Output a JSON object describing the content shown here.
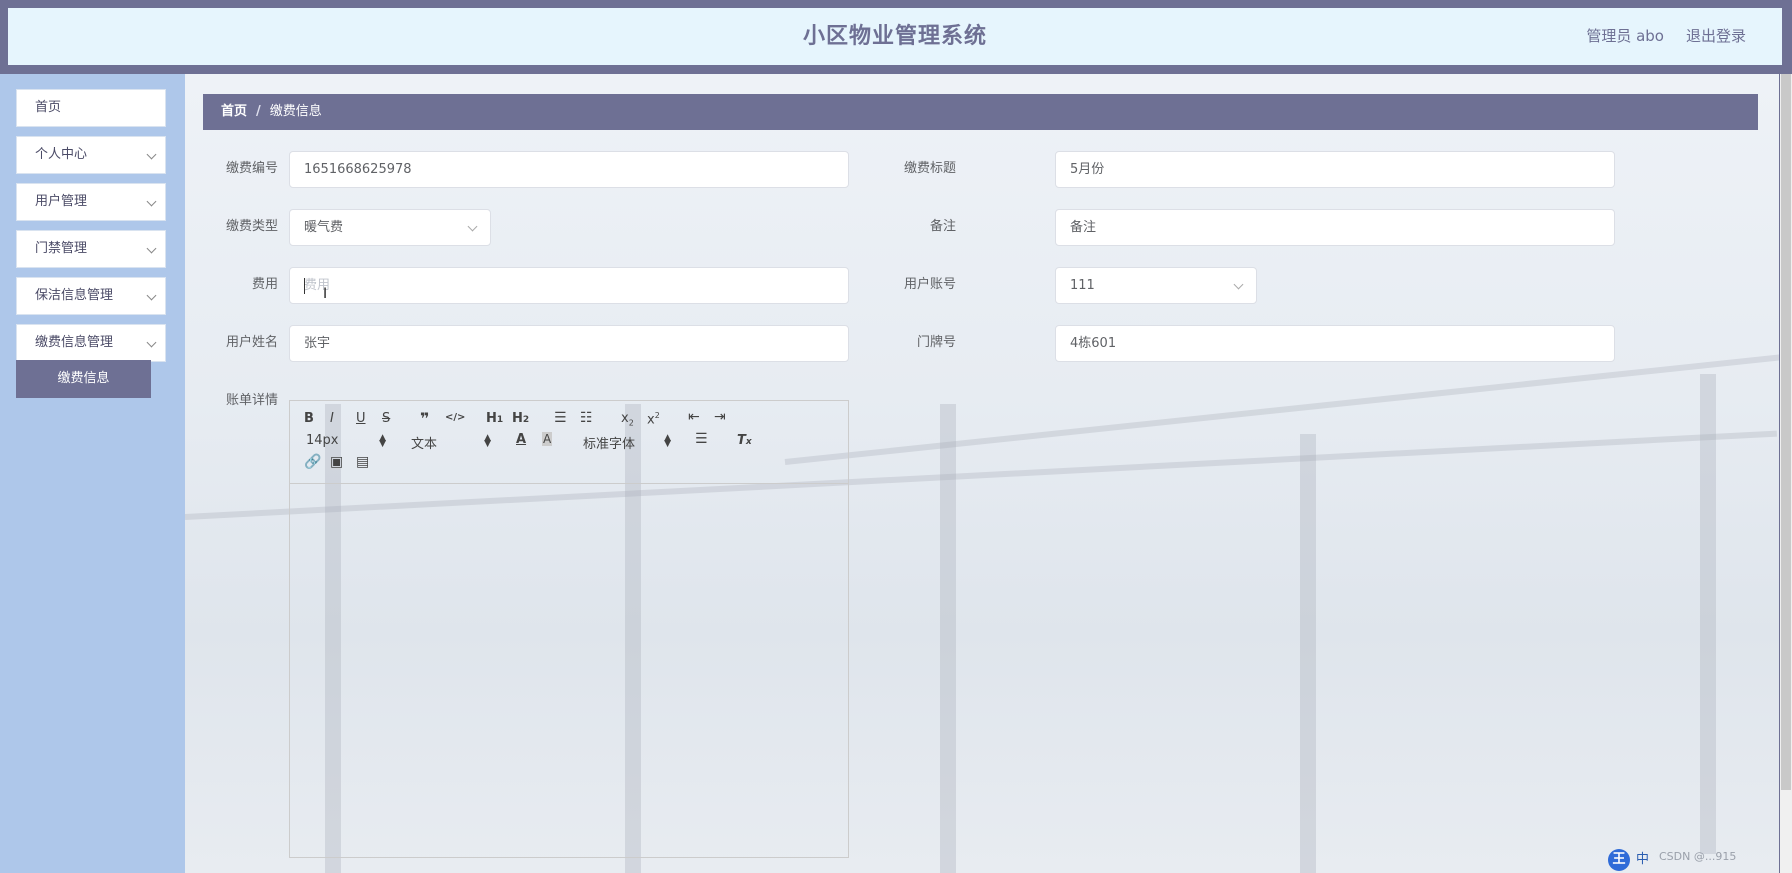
{
  "header": {
    "title": "小区物业管理系统",
    "user": "管理员 abo",
    "logout": "退出登录"
  },
  "sidebar": {
    "items": [
      {
        "label": "首页",
        "has_children": false
      },
      {
        "label": "个人中心",
        "has_children": true
      },
      {
        "label": "用户管理",
        "has_children": true
      },
      {
        "label": "门禁管理",
        "has_children": true
      },
      {
        "label": "保洁信息管理",
        "has_children": true
      },
      {
        "label": "缴费信息管理",
        "has_children": true
      }
    ],
    "active_subitem": "缴费信息"
  },
  "breadcrumb": {
    "home": "首页",
    "separator": "/",
    "current": "缴费信息"
  },
  "form": {
    "payment_no": {
      "label": "缴费编号",
      "value": "1651668625978"
    },
    "payment_title": {
      "label": "缴费标题",
      "value": "5月份"
    },
    "payment_type": {
      "label": "缴费类型",
      "value": "暖气费"
    },
    "remark": {
      "label": "备注",
      "value": "备注"
    },
    "fee": {
      "label": "费用",
      "placeholder": "费用"
    },
    "user_account": {
      "label": "用户账号",
      "value": "111"
    },
    "user_name": {
      "label": "用户姓名",
      "value": "张宇"
    },
    "door_no": {
      "label": "门牌号",
      "value": "4栋601"
    },
    "bill_detail": {
      "label": "账单详情"
    }
  },
  "editor": {
    "font_size": "14px",
    "block_format": "文本",
    "font_family": "标准字体",
    "buttons": [
      "bold",
      "italic",
      "underline",
      "strike",
      "blockquote",
      "code-block",
      "header-1",
      "header-2",
      "ordered-list",
      "bullet-list",
      "subscript",
      "superscript",
      "outdent",
      "indent",
      "font-color",
      "background-color",
      "align",
      "clean",
      "link",
      "image",
      "video"
    ]
  },
  "tray": {
    "ime_label": "王",
    "lang": "中",
    "watermark": "CSDN @...915"
  },
  "colors": {
    "primary": "#6e7094",
    "sidebar_bg": "#aec7ea",
    "header_bg": "#e6f5fd"
  }
}
